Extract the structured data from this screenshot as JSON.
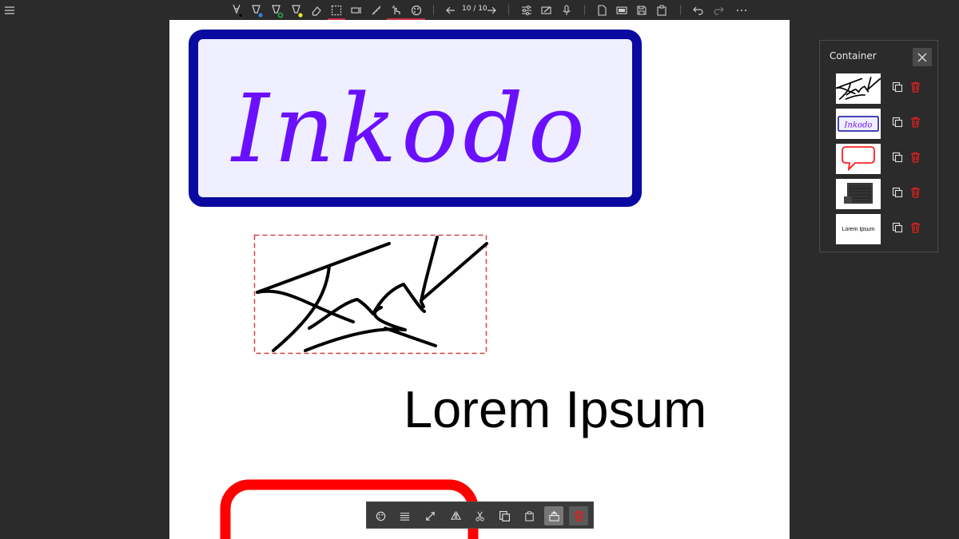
{
  "toolbar": {
    "page_counter": "10 / 10",
    "buttons": [
      "menu-icon",
      "pen-icon",
      "highlighter-icon",
      "pencil-icon",
      "marker-icon",
      "eraser-icon",
      "lasso-select-icon",
      "keyboard-icon",
      "ruler-icon",
      "touch-write-icon",
      "color-palette-icon",
      "arrow-left-icon",
      "arrow-right-icon",
      "settings-sliders-icon",
      "sign-icon",
      "microphone-icon",
      "new-page-icon",
      "image-icon",
      "save-icon",
      "paste-icon",
      "undo-icon",
      "redo-icon",
      "more-icon"
    ],
    "pen_colors": [
      "#000000",
      "#3a7bd5",
      "#1db954",
      "#e8e82a"
    ]
  },
  "canvas": {
    "logo_text": "Inkodo",
    "logo_fill": "#efefff",
    "logo_border": "#0a0aa0",
    "logo_text_color": "#6a10ff",
    "lorem_text": "Lorem Ipsum",
    "bubble_color": "#ff0000",
    "selection_color": "#d24040"
  },
  "container_panel": {
    "title": "Container",
    "items": [
      {
        "type": "signature"
      },
      {
        "type": "logo",
        "text": "Inkodo"
      },
      {
        "type": "speech-bubble"
      },
      {
        "type": "image"
      },
      {
        "type": "text",
        "text": "Lorem Ipsum"
      }
    ],
    "delete_color": "#e02020"
  },
  "context_toolbar": {
    "buttons": [
      "color-palette-icon",
      "line-style-icon",
      "resize-icon",
      "flip-icon",
      "cut-icon",
      "copy-icon",
      "paste-icon",
      "add-to-container-icon",
      "delete-icon"
    ]
  }
}
